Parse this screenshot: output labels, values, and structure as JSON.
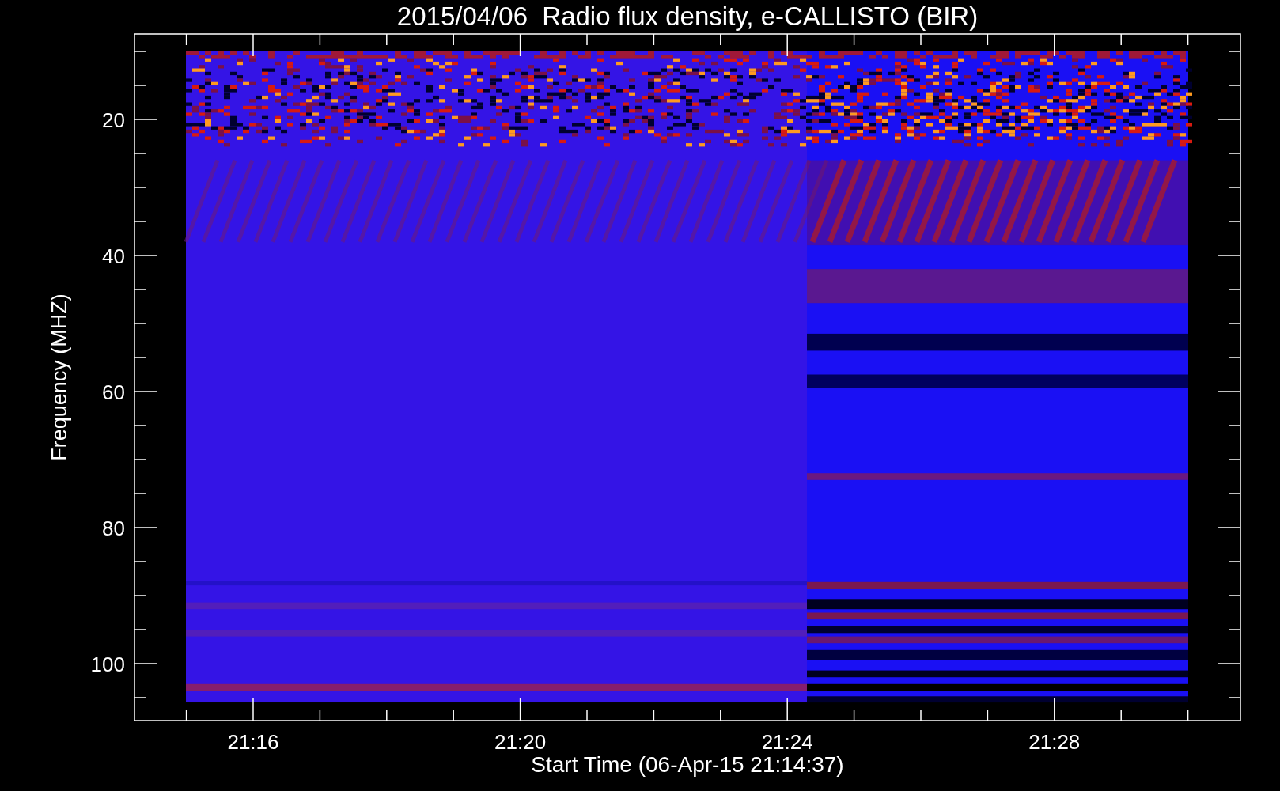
{
  "title": "2015/04/06  Radio flux density, e-CALLISTO (BIR)",
  "plot": {
    "ylabel": "Frequency (MHZ)",
    "xlabel": "Start Time (06-Apr-15 21:14:37)",
    "yticks": [
      "20",
      "40",
      "60",
      "80",
      "100"
    ],
    "xticks": [
      "21:16",
      "21:20",
      "21:24",
      "21:28"
    ]
  }
}
